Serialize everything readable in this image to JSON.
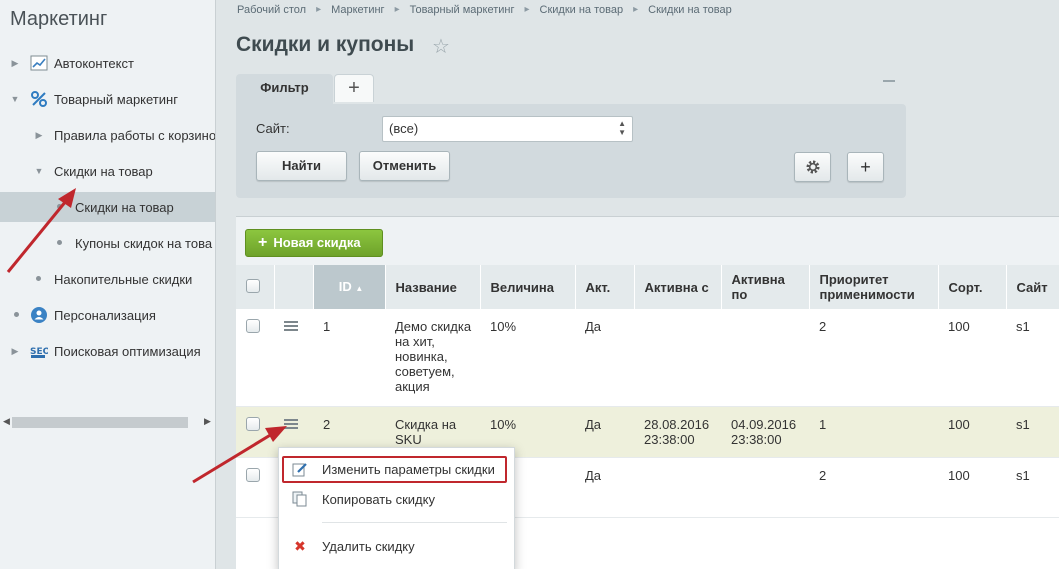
{
  "sidebar": {
    "title": "Маркетинг",
    "items": [
      {
        "label": "Автоконтекст",
        "icon": "chart-icon"
      },
      {
        "label": "Товарный маркетинг",
        "icon": "percent-icon"
      },
      {
        "label": "Правила работы с корзино"
      },
      {
        "label": "Скидки на товар"
      },
      {
        "label": "Скидки на товар"
      },
      {
        "label": "Купоны скидок на това"
      },
      {
        "label": "Накопительные скидки"
      },
      {
        "label": "Персонализация",
        "icon": "person-icon"
      },
      {
        "label": "Поисковая оптимизация",
        "icon": "seo-icon"
      }
    ]
  },
  "breadcrumb": [
    "Рабочий стол",
    "Маркетинг",
    "Товарный маркетинг",
    "Скидки на товар",
    "Скидки на товар"
  ],
  "page_title": "Скидки и купоны",
  "filter": {
    "tab_label": "Фильтр",
    "site_label": "Сайт:",
    "site_value": "(все)",
    "find_button": "Найти",
    "cancel_button": "Отменить"
  },
  "grid": {
    "new_button": "Новая скидка",
    "headers": {
      "id": "ID",
      "name": "Название",
      "value": "Величина",
      "active": "Акт.",
      "active_from": "Активна с",
      "active_to": "Активна по",
      "priority": "Приоритет применимости",
      "sort": "Сорт.",
      "site": "Сайт"
    },
    "rows": [
      {
        "id": "1",
        "name": "Демо скидка на хит, новинка, советуем, акция",
        "value": "10%",
        "active": "Да",
        "from": "",
        "to": "",
        "priority": "2",
        "sort": "100",
        "site": "s1"
      },
      {
        "id": "2",
        "name": "Скидка на SKU",
        "value": "10%",
        "active": "Да",
        "from": "28.08.2016 23:38:00",
        "to": "04.09.2016 23:38:00",
        "priority": "1",
        "sort": "100",
        "site": "s1"
      },
      {
        "id": "",
        "name": "",
        "value": "",
        "active": "Да",
        "from": "",
        "to": "",
        "priority": "2",
        "sort": "100",
        "site": "s1"
      }
    ]
  },
  "context_menu": {
    "edit": "Изменить параметры скидки",
    "copy": "Копировать скидку",
    "delete": "Удалить скидку"
  },
  "colors": {
    "highlight": "#c0272d",
    "green_button": "#7ab534",
    "selected_row": "#eef0dc"
  }
}
